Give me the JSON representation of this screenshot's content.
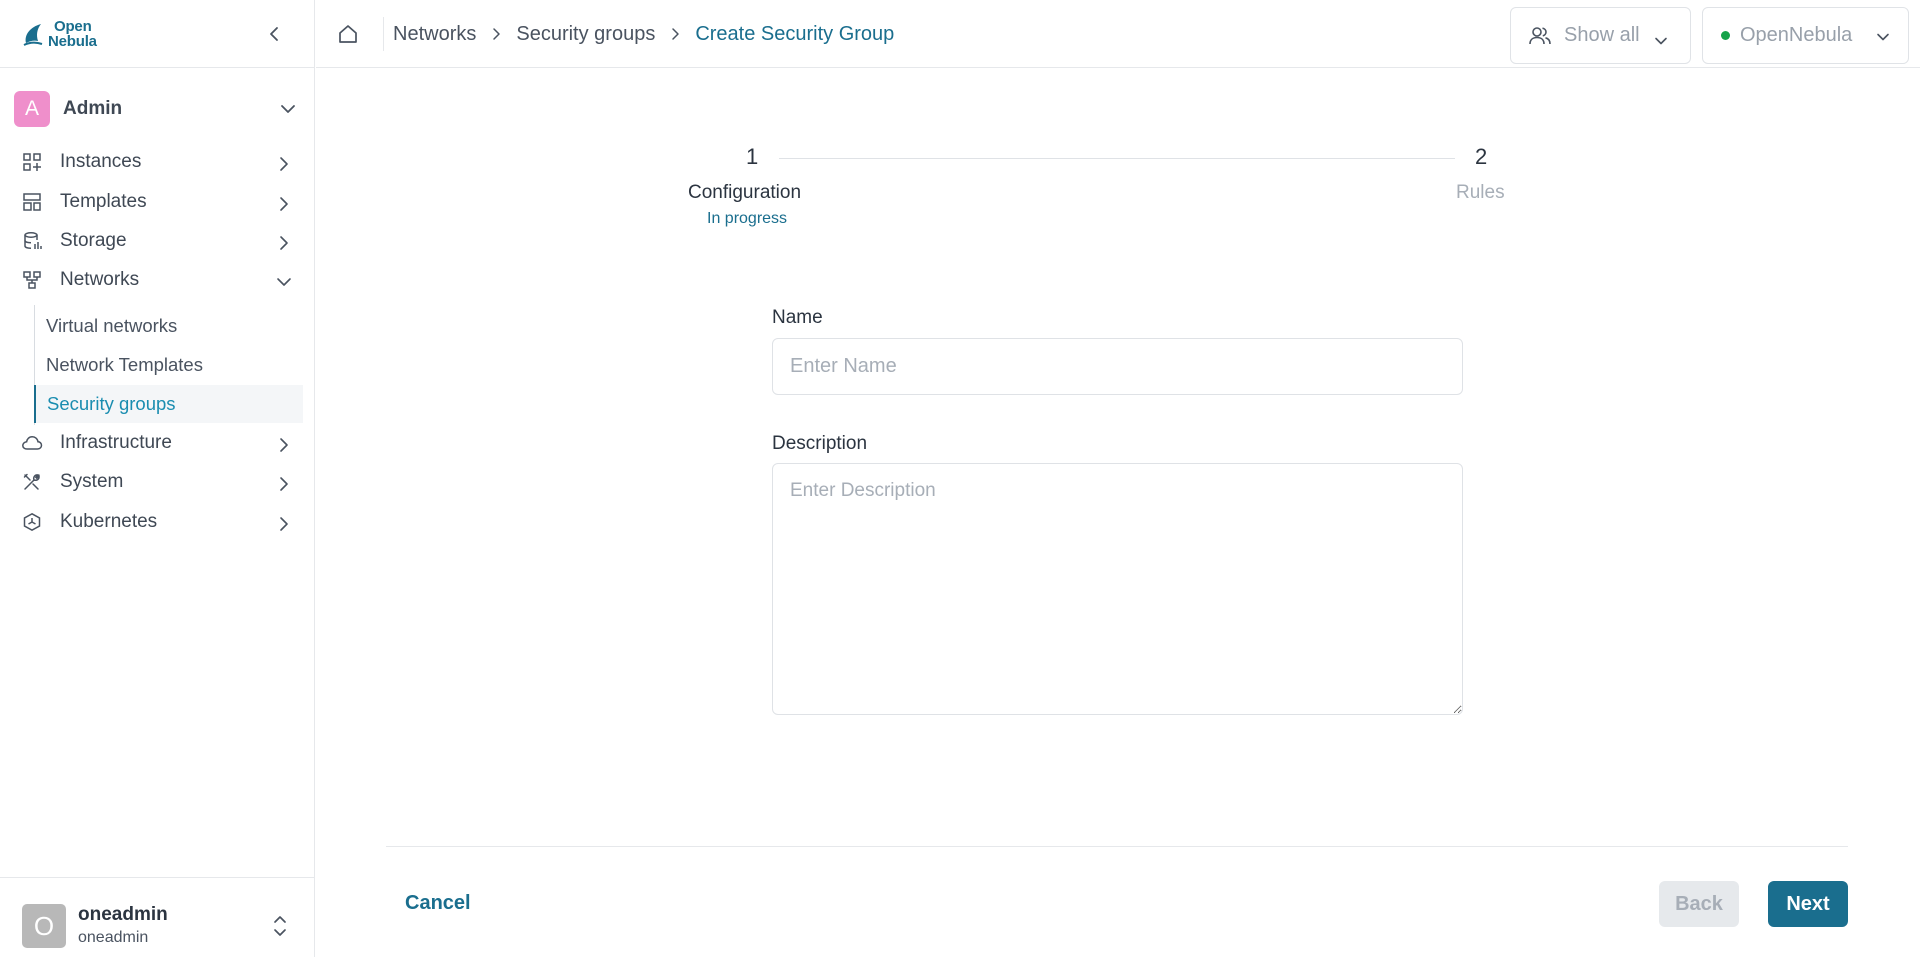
{
  "sidebar": {
    "logo": {
      "line1": "Open",
      "line2": "Nebula"
    },
    "group": {
      "avatar_letter": "A",
      "label": "Admin",
      "avatar_color": "#ef8fcb"
    },
    "nav": {
      "instances": "Instances",
      "templates": "Templates",
      "storage": "Storage",
      "networks": "Networks",
      "infrastructure": "Infrastructure",
      "system": "System",
      "kubernetes": "Kubernetes"
    },
    "networks_sub": {
      "virtual_networks": "Virtual networks",
      "network_templates": "Network Templates",
      "security_groups": "Security groups"
    },
    "user": {
      "avatar_letter": "O",
      "name": "oneadmin",
      "group": "oneadmin"
    }
  },
  "header": {
    "breadcrumb": [
      "Networks",
      "Security groups",
      "Create Security Group"
    ],
    "show_all": "Show all",
    "zone": "OpenNebula",
    "zone_status_color": "#16a34a"
  },
  "stepper": {
    "steps": [
      {
        "number": "1",
        "label": "Configuration",
        "status": "In progress"
      },
      {
        "number": "2",
        "label": "Rules"
      }
    ]
  },
  "form": {
    "name_label": "Name",
    "name_placeholder": "Enter Name",
    "description_label": "Description",
    "description_placeholder": "Enter Description"
  },
  "footer": {
    "cancel": "Cancel",
    "back": "Back",
    "next": "Next"
  },
  "colors": {
    "accent": "#1a6e8e",
    "active_link": "#1a8db0"
  }
}
